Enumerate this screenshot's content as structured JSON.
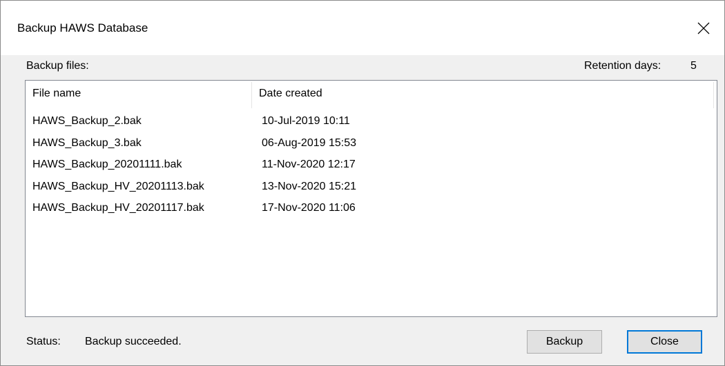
{
  "window": {
    "title": "Backup HAWS Database"
  },
  "backup_files_label": "Backup files:",
  "retention": {
    "label": "Retention days:",
    "value": "5"
  },
  "table": {
    "columns": [
      "File name",
      "Date created"
    ],
    "rows": [
      {
        "name": "HAWS_Backup_2.bak",
        "date": "10-Jul-2019 10:11"
      },
      {
        "name": "HAWS_Backup_3.bak",
        "date": "06-Aug-2019 15:53"
      },
      {
        "name": "HAWS_Backup_20201111.bak",
        "date": "11-Nov-2020 12:17"
      },
      {
        "name": "HAWS_Backup_HV_20201113.bak",
        "date": "13-Nov-2020 15:21"
      },
      {
        "name": "HAWS_Backup_HV_20201117.bak",
        "date": "17-Nov-2020 11:06"
      }
    ]
  },
  "status": {
    "label": "Status:",
    "text": "Backup succeeded."
  },
  "buttons": {
    "backup": "Backup",
    "close": "Close"
  },
  "colors": {
    "window_bg": "#f0f0f0",
    "default_button_border": "#0078d7"
  },
  "icons": {
    "close": "close-icon"
  }
}
